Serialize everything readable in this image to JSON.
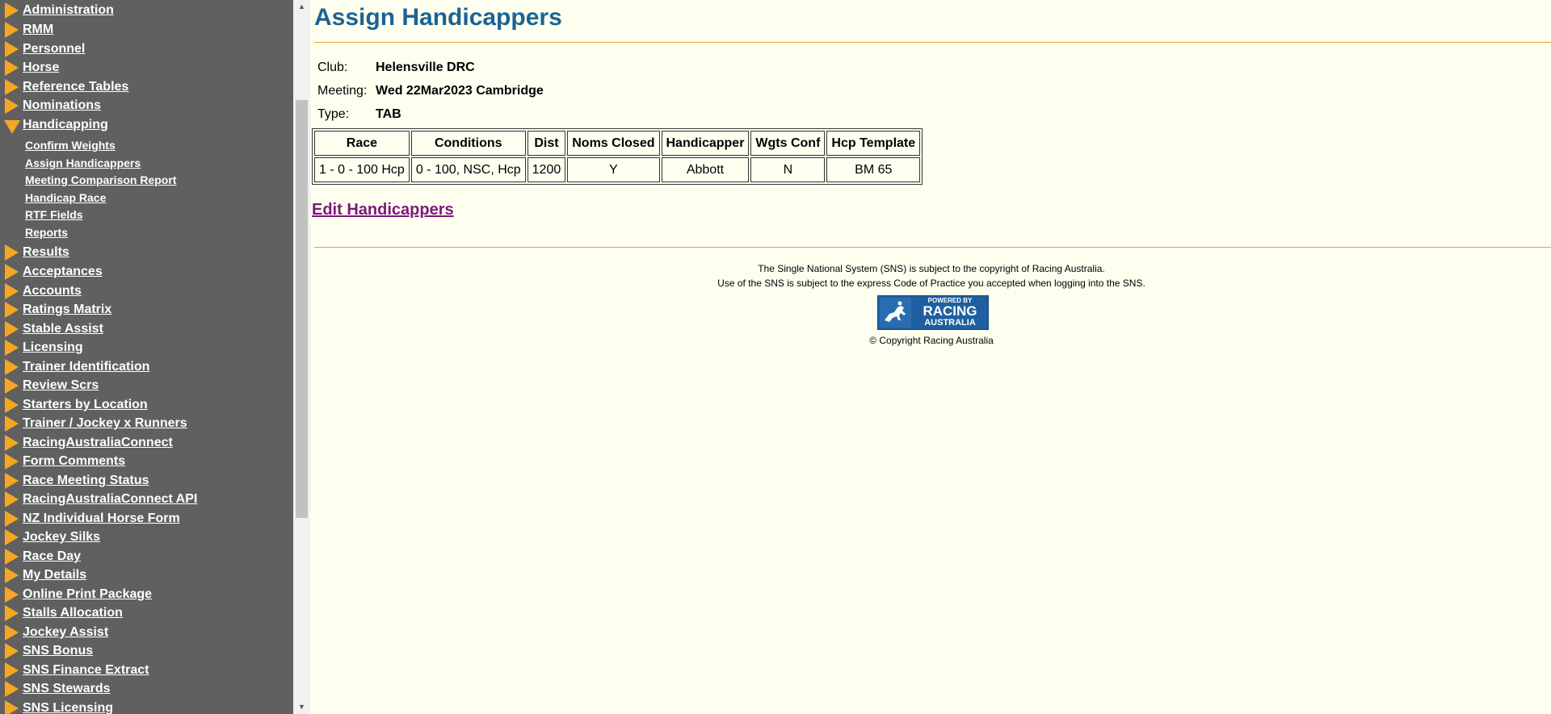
{
  "sidebar": {
    "items": [
      {
        "label": "Administration"
      },
      {
        "label": "RMM"
      },
      {
        "label": "Personnel"
      },
      {
        "label": "Horse"
      },
      {
        "label": "Reference Tables"
      },
      {
        "label": "Nominations"
      },
      {
        "label": "Handicapping",
        "expanded": true,
        "sub_items": [
          {
            "label": "Confirm Weights"
          },
          {
            "label": "Assign Handicappers"
          },
          {
            "label": "Meeting Comparison Report"
          },
          {
            "label": "Handicap Race"
          },
          {
            "label": "RTF Fields"
          },
          {
            "label": "Reports"
          }
        ]
      },
      {
        "label": "Results"
      },
      {
        "label": "Acceptances"
      },
      {
        "label": "Accounts"
      },
      {
        "label": "Ratings Matrix"
      },
      {
        "label": "Stable Assist"
      },
      {
        "label": "Licensing"
      },
      {
        "label": "Trainer Identification"
      },
      {
        "label": "Review Scrs"
      },
      {
        "label": "Starters by Location"
      },
      {
        "label": "Trainer / Jockey x Runners"
      },
      {
        "label": "RacingAustraliaConnect"
      },
      {
        "label": "Form Comments"
      },
      {
        "label": "Race Meeting Status"
      },
      {
        "label": "RacingAustraliaConnect API"
      },
      {
        "label": "NZ Individual Horse Form"
      },
      {
        "label": "Jockey Silks"
      },
      {
        "label": "Race Day"
      },
      {
        "label": "My Details"
      },
      {
        "label": "Online Print Package"
      },
      {
        "label": "Stalls Allocation"
      },
      {
        "label": "Jockey Assist"
      },
      {
        "label": "SNS Bonus"
      },
      {
        "label": "SNS Finance Extract"
      },
      {
        "label": "SNS Stewards"
      },
      {
        "label": "SNS Licensing"
      }
    ]
  },
  "main": {
    "title": "Assign Handicappers",
    "info": {
      "club_label": "Club:",
      "club_value": "Helensville DRC",
      "meeting_label": "Meeting:",
      "meeting_value": "Wed 22Mar2023 Cambridge",
      "type_label": "Type:",
      "type_value": "TAB"
    },
    "table": {
      "headers": [
        "Race",
        "Conditions",
        "Dist",
        "Noms Closed",
        "Handicapper",
        "Wgts Conf",
        "Hcp Template"
      ],
      "rows": [
        [
          "1 - 0 - 100 Hcp",
          "0 - 100, NSC, Hcp",
          "1200",
          "Y",
          "Abbott",
          "N",
          "BM 65"
        ]
      ]
    },
    "edit_link": "Edit Handicappers"
  },
  "footer": {
    "line1": "The Single National System (SNS) is subject to the copyright of Racing Australia.",
    "line2": "Use of the SNS is subject to the express Code of Practice you accepted when logging into the SNS.",
    "logo_top": "POWERED BY",
    "logo_mid": "RACING",
    "logo_bottom": "AUSTRALIA",
    "copyright": "© Copyright Racing Australia"
  },
  "colors": {
    "sidebar_bg": "#606060",
    "accent_triangle": "#f5a623",
    "page_bg": "#fffff0",
    "title_color": "#1a6496",
    "rule_color": "#e8a33d",
    "visited_link": "#7b1a7b"
  }
}
